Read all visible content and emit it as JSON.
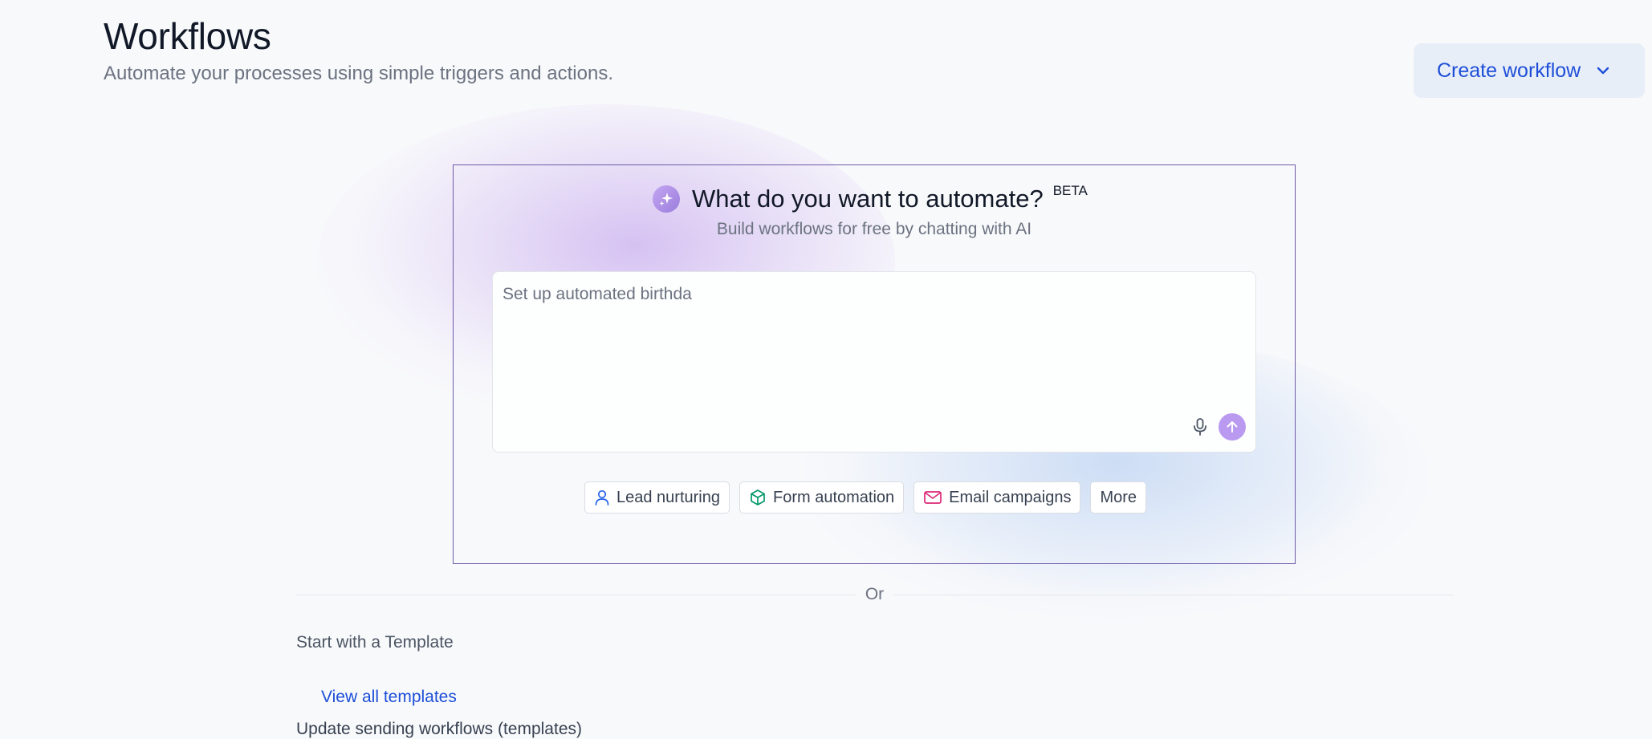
{
  "header": {
    "title": "Workflows",
    "subtitle": "Automate your processes using simple triggers and actions.",
    "create_button_label": "Create workflow"
  },
  "ai_builder": {
    "title": "What do you want to automate?",
    "badge": "BETA",
    "subtitle": "Build workflows for free by chatting with AI",
    "prompt_value": "Set up automated birthda",
    "icons": {
      "heading": "sparkle-icon",
      "mic": "microphone-icon",
      "send": "arrow-up-icon"
    },
    "suggestions": [
      {
        "label": "Lead nurturing",
        "icon": "user-icon",
        "color": "#2563eb"
      },
      {
        "label": "Form automation",
        "icon": "cube-icon",
        "color": "#059669"
      },
      {
        "label": "Email campaigns",
        "icon": "mail-icon",
        "color": "#db2777"
      },
      {
        "label": "More",
        "icon": "",
        "color": ""
      }
    ],
    "accent_color": "#b99af0"
  },
  "divider": {
    "label": "Or"
  },
  "templates": {
    "heading": "Start with a Template",
    "view_all_label": "View all templates",
    "next_section_partial": "Update sending workflows (templates)"
  },
  "colors": {
    "link": "#1d4ed8",
    "card_border": "#6d5aa8",
    "background": "#f8f9fb"
  }
}
